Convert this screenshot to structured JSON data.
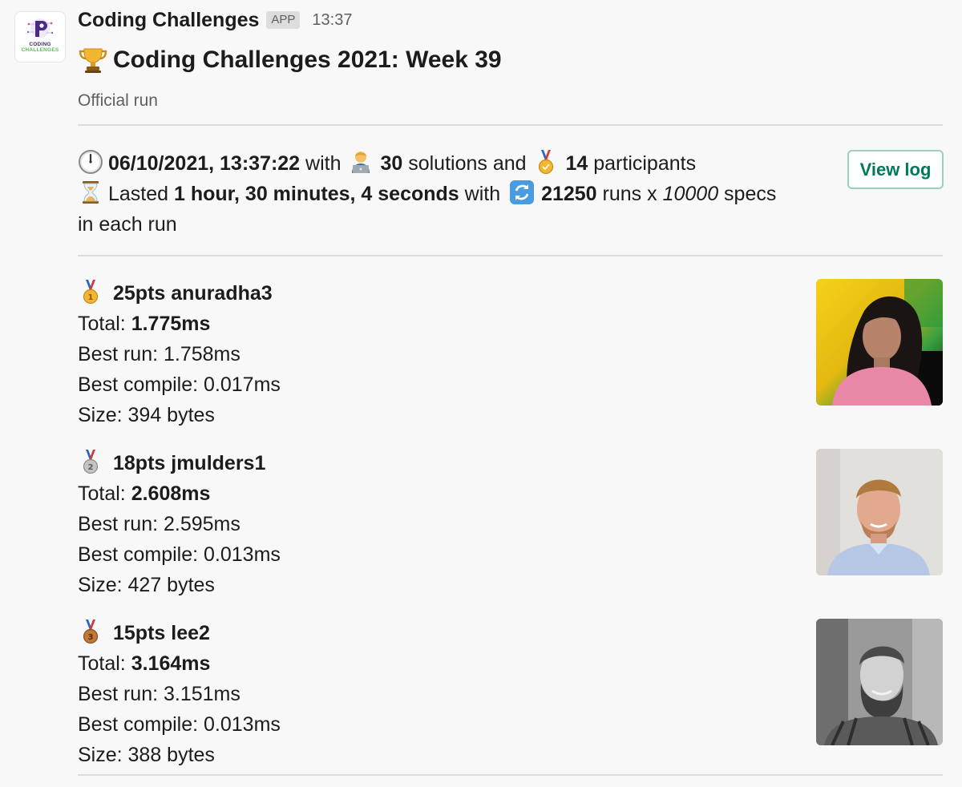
{
  "message": {
    "sender": "Coding Challenges",
    "badge": "APP",
    "time": "13:37",
    "logo_text_line1": "CODING",
    "logo_text_line2": "CHALLENGES"
  },
  "header": {
    "title": "Coding Challenges 2021: Week 39",
    "subtitle": "Official run"
  },
  "run_info": {
    "datetime": "06/10/2021, 13:37:22",
    "with_1": " with ",
    "solutions_count": "30",
    "solutions_label": " solutions and ",
    "participants_count": "14",
    "participants_label": " participants",
    "lasted_label": "Lasted ",
    "duration": "1 hour, 30 minutes, 4 seconds",
    "with_2": " with ",
    "runs_count": "21250",
    "runs_label": " runs x ",
    "specs_count": "10000",
    "specs_label": " specs",
    "tail": "in each run",
    "view_log_label": "View log"
  },
  "results": [
    {
      "medal": "gold",
      "points_user": "25pts anuradha3",
      "total_label": "Total: ",
      "total_value": "1.775ms",
      "best_run": "Best run: 1.758ms",
      "best_compile": "Best compile: 0.017ms",
      "size": "Size: 394 bytes"
    },
    {
      "medal": "silver",
      "points_user": "18pts jmulders1",
      "total_label": "Total: ",
      "total_value": "2.608ms",
      "best_run": "Best run: 2.595ms",
      "best_compile": "Best compile: 0.013ms",
      "size": "Size: 427 bytes"
    },
    {
      "medal": "bronze",
      "points_user": "15pts lee2",
      "total_label": "Total: ",
      "total_value": "3.164ms",
      "best_run": "Best run: 3.151ms",
      "best_compile": "Best compile: 0.013ms",
      "size": "Size: 388 bytes"
    }
  ],
  "icons": {
    "title": "trophy-icon",
    "datetime": "clock-icon",
    "solutions": "technologist-icon",
    "participants": "sports-medal-icon",
    "duration": "hourglass-icon",
    "runs": "refresh-icon"
  },
  "colors": {
    "accent_green": "#007a5a",
    "gold": "#f2b632",
    "silver": "#b8b8b8",
    "bronze": "#c0773a"
  }
}
